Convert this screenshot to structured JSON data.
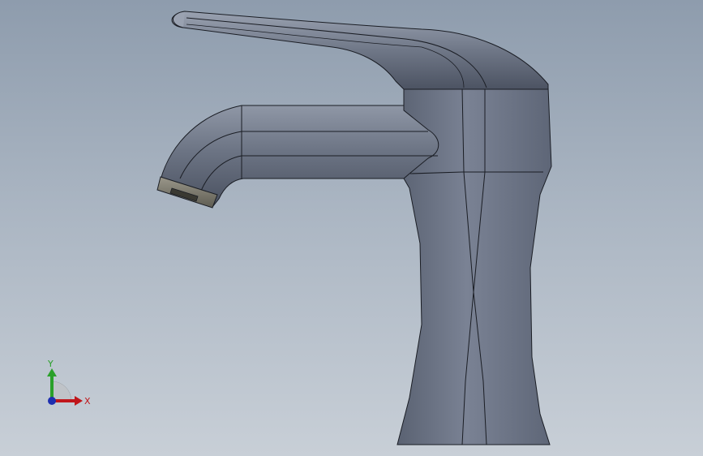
{
  "viewport": {
    "background_top": "#8e9cad",
    "background_bottom": "#c8cfd7"
  },
  "model": {
    "name": "faucet-model",
    "body_color": "#6d7585",
    "edge_color": "#1a1d24",
    "aerator_color": "#7c7a6e"
  },
  "triad": {
    "x_label": "X",
    "y_label": "Y",
    "x_color": "#c0161b",
    "y_color": "#2aa02a",
    "z_color": "#1e2fb0"
  }
}
